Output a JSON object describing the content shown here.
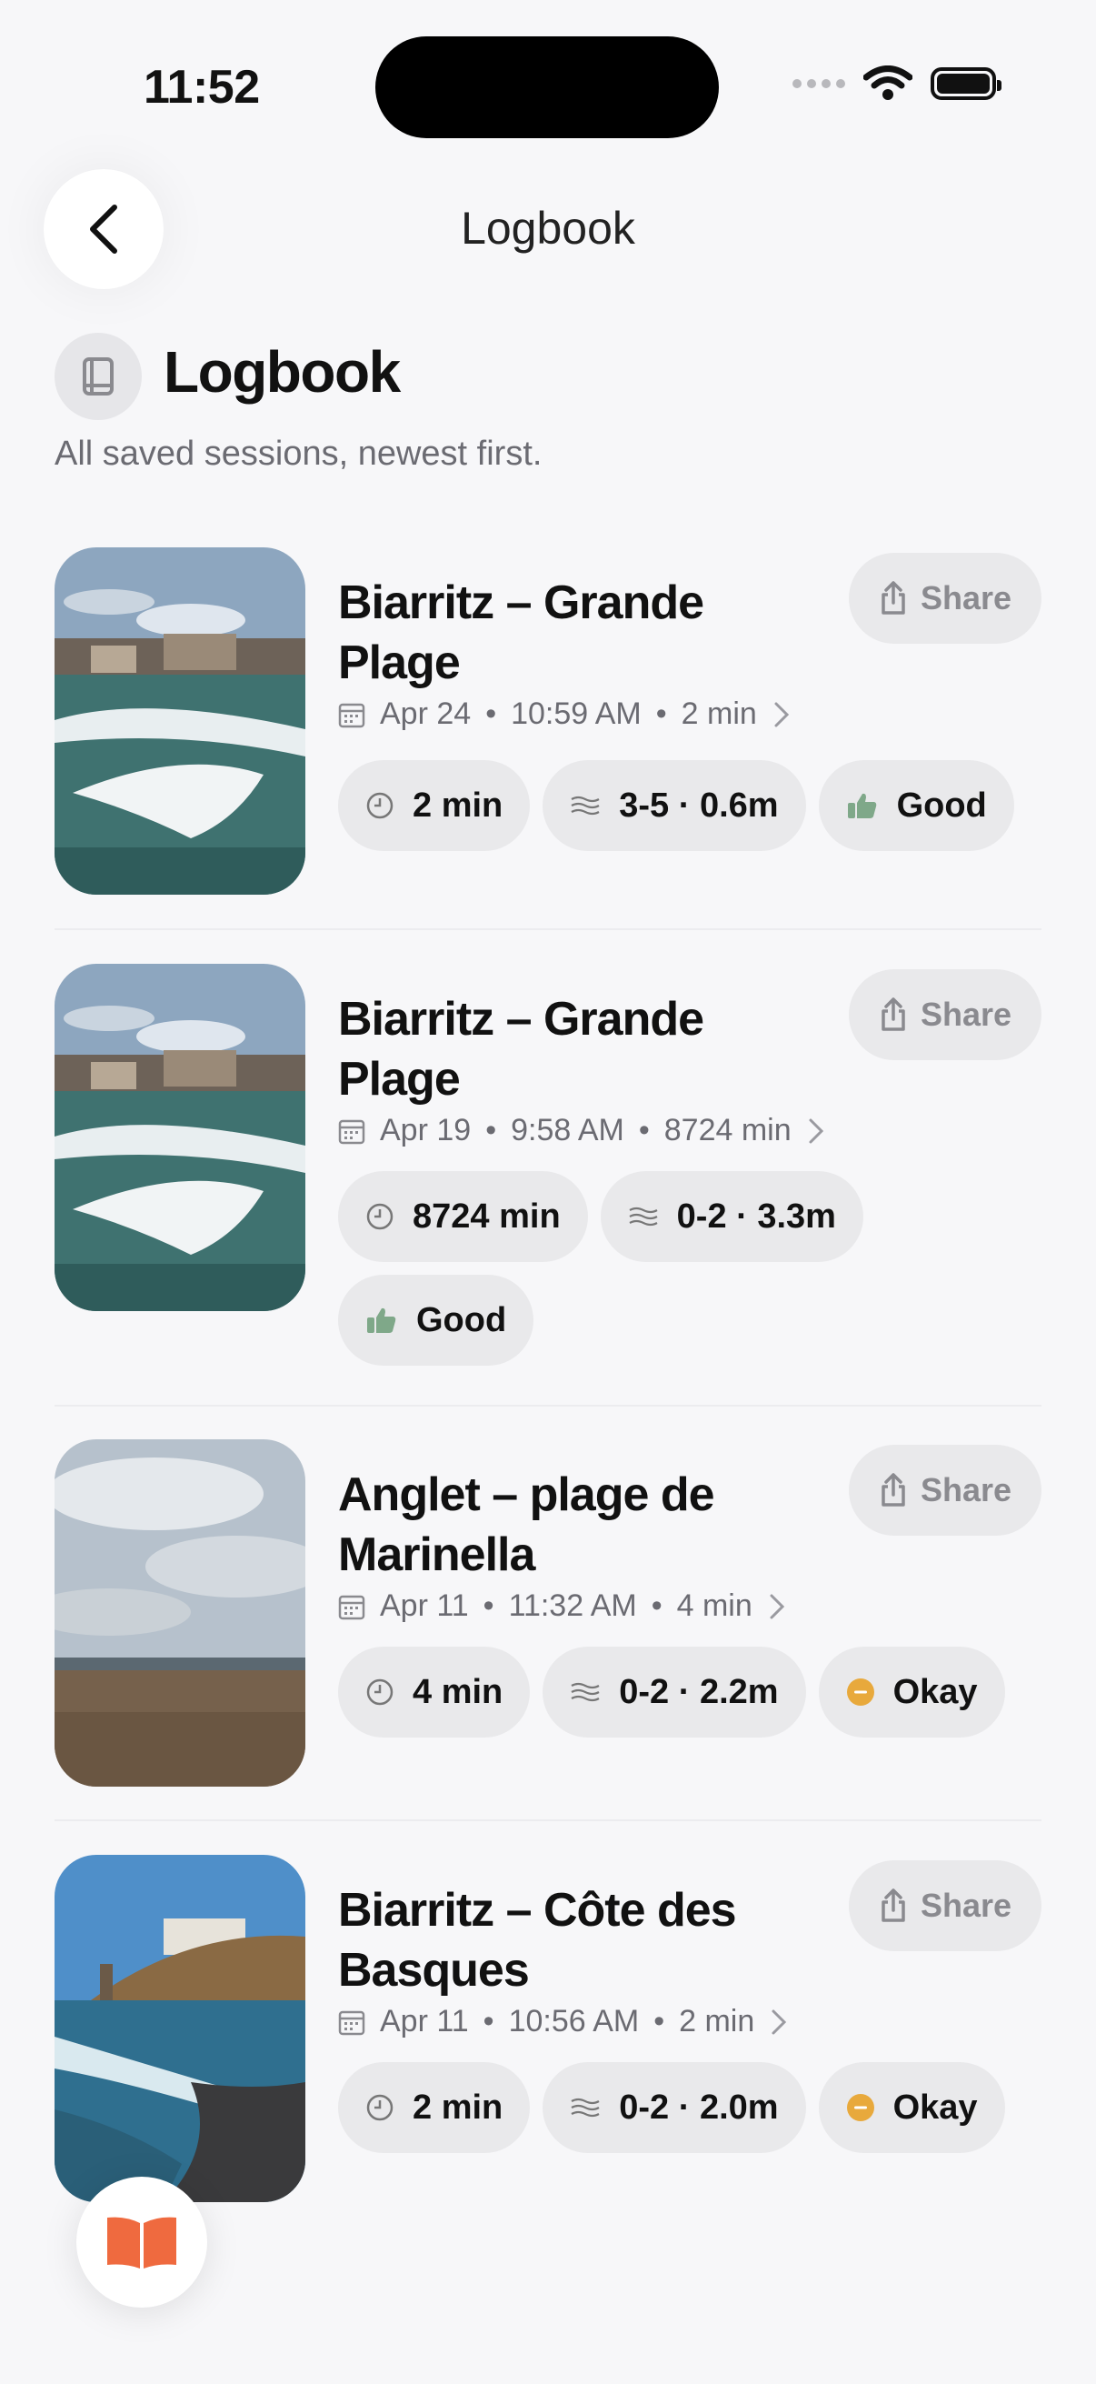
{
  "status": {
    "time": "11:52"
  },
  "nav": {
    "title": "Logbook"
  },
  "header": {
    "title": "Logbook",
    "subtitle": "All saved sessions, newest first."
  },
  "sessions": [
    {
      "title": "Biarritz – Grande Plage",
      "date": "Apr 24",
      "time": "10:59 AM",
      "duration": "2 min",
      "chips": {
        "duration": "2 min",
        "waves": "3-5 · 0.6m",
        "rating": "Good"
      },
      "share": "Share"
    },
    {
      "title": "Biarritz – Grande Plage",
      "date": "Apr 19",
      "time": "9:58 AM",
      "duration": "8724 min",
      "chips": {
        "duration": "8724 min",
        "waves": "0-2 · 3.3m",
        "rating": "Good"
      },
      "share": "Share"
    },
    {
      "title": "Anglet – plage de Marinella",
      "date": "Apr 11",
      "time": "11:32 AM",
      "duration": "4 min",
      "chips": {
        "duration": "4 min",
        "waves": "0-2 · 2.2m",
        "rating": "Okay"
      },
      "share": "Share"
    },
    {
      "title": "Biarritz – Côte des Basques",
      "date": "Apr 11",
      "time": "10:56 AM",
      "duration": "2 min",
      "chips": {
        "duration": "2 min",
        "waves": "0-2 · 2.0m",
        "rating": "Okay"
      },
      "share": "Share"
    }
  ],
  "separator": "•",
  "colors": {
    "good": "#7fa889",
    "okay": "#e8a93c",
    "accent": "#ef6a3f"
  }
}
